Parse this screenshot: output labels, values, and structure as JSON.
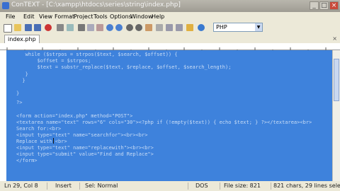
{
  "window": {
    "title": "ConTEXT - [C:\\xampp\\htdocs\\series\\string\\index.php]",
    "min_label": "_",
    "max_label": "□",
    "close_label": "×"
  },
  "menu": [
    "File",
    "Edit",
    "View",
    "Format",
    "Project",
    "Tools",
    "Options",
    "Window",
    "Help"
  ],
  "toolbar": {
    "highlighter": "PHP",
    "icons": [
      "new-file-icon",
      "open-icon",
      "save-icon",
      "save-all-icon",
      "close-file-icon",
      "print-icon",
      "preview-icon",
      "cut-icon",
      "copy-icon",
      "paste-icon",
      "undo-icon",
      "redo-icon",
      "find-icon",
      "find-next-icon",
      "replace-icon",
      "word-wrap-icon",
      "indent-icon",
      "outdent-icon",
      "bookmark-icon",
      "help-icon"
    ]
  },
  "tab": {
    "label": "index.php",
    "close": "×"
  },
  "editor": {
    "lines": [
      "   while ($strpos = strpos($text, $search, $offset)) {",
      "       $offset = $strpos;",
      "       $text = substr_replace($text, $replace, $offset, $search_length);",
      "   }",
      "  }",
      "",
      "}",
      "",
      "?>",
      "",
      "<form action=\"index.php\" method=\"POST\">",
      "<textarea name=\"text\" rows=\"6\" cols=\"30\"><?php if (!empty($text)) { echo $text; } ?></textarea><br>",
      "Search for:<br>",
      "<input type=\"text\" name=\"searchfor\"><br><br>",
      "Replace with:<br>",
      "<input type=\"text\" name=\"replacewith\"><br><br>",
      "<input type=\"submit\" value=\"Find and Replace\">",
      "</form>"
    ]
  },
  "status": {
    "position": "Ln 29, Col 8",
    "mode": "Insert",
    "selection": "Sel: Normal",
    "format": "DOS",
    "file_size": "File size: 821",
    "summary": "821 chars, 29 lines selected"
  }
}
